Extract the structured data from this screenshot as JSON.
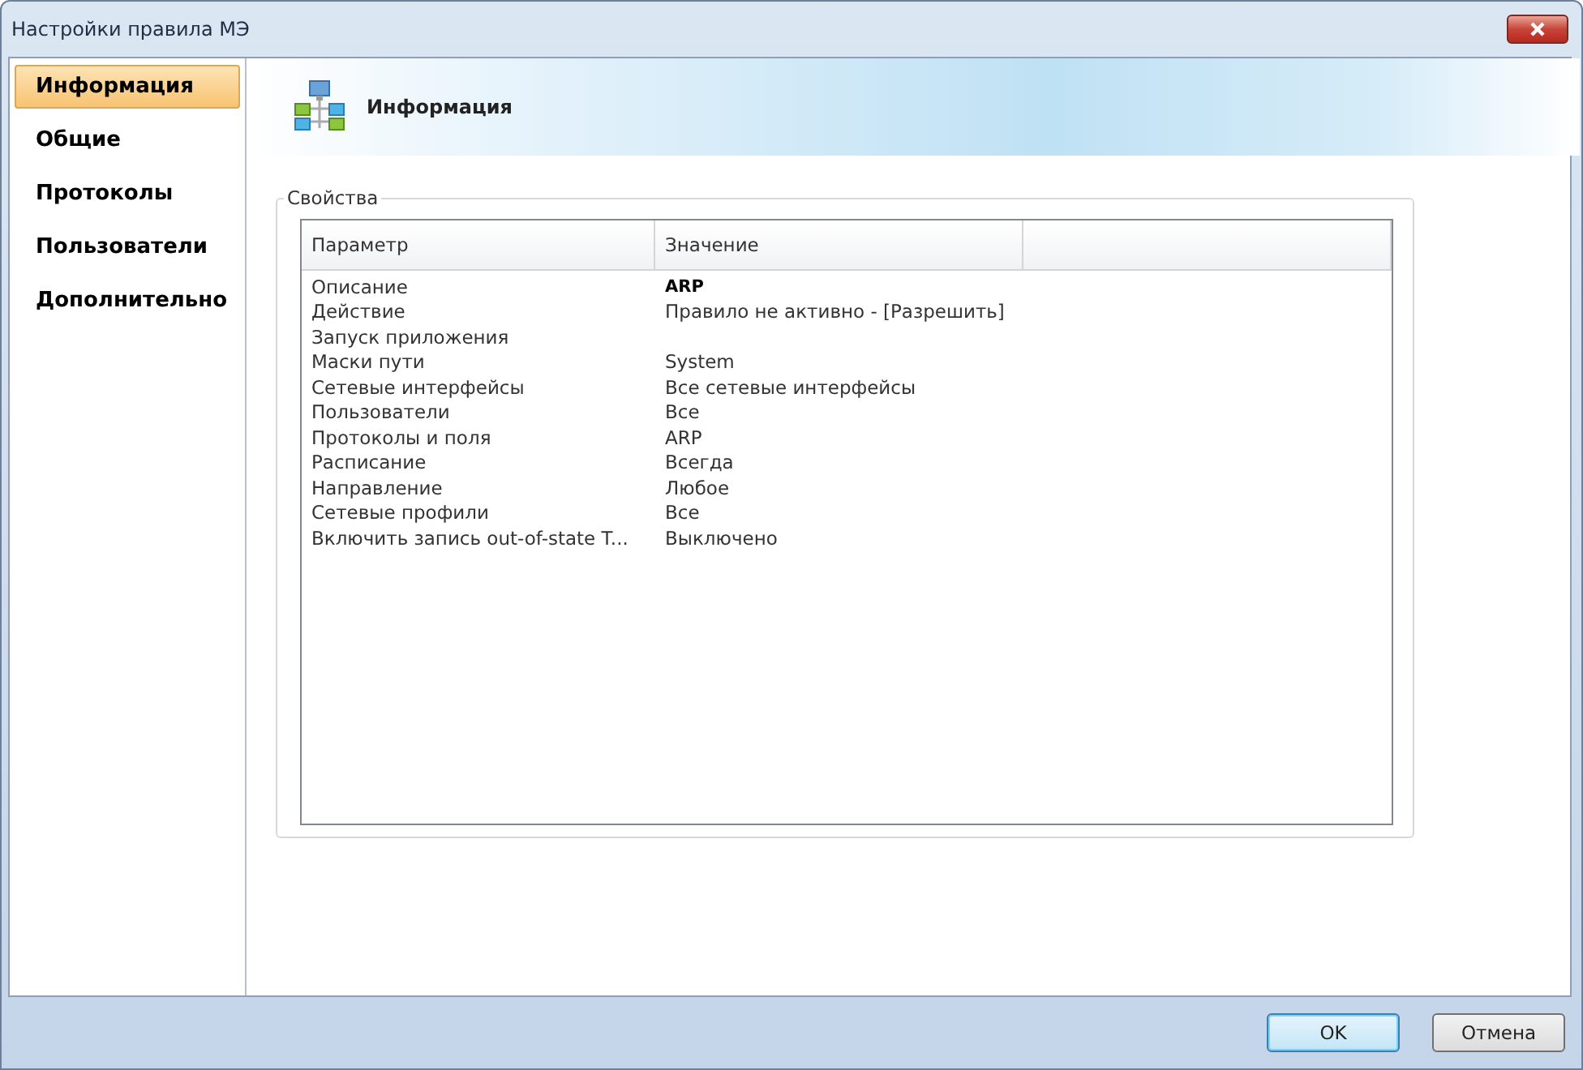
{
  "window": {
    "title": "Настройки правила МЭ"
  },
  "sidebar": {
    "items": [
      {
        "label": "Информация",
        "selected": true
      },
      {
        "label": "Общие",
        "selected": false
      },
      {
        "label": "Протоколы",
        "selected": false
      },
      {
        "label": "Пользователи",
        "selected": false
      },
      {
        "label": "Дополнительно",
        "selected": false
      }
    ]
  },
  "header": {
    "title": "Информация"
  },
  "properties": {
    "title": "Свойства",
    "columns": [
      "Параметр",
      "Значение"
    ],
    "rows": [
      {
        "name": "Описание",
        "value": "ARP",
        "emphasis": true
      },
      {
        "name": "Действие",
        "value": "Правило не активно - [Разрешить]"
      },
      {
        "name": "Запуск приложения"
      },
      {
        "name": "Маски пути",
        "value": "System"
      },
      {
        "name": "Сетевые интерфейсы",
        "value": "Все сетевые интерфейсы"
      },
      {
        "name": "Пользователи",
        "value": "Все"
      },
      {
        "name": "Протоколы и поля",
        "value": "ARP"
      },
      {
        "name": "Расписание",
        "value": "Всегда"
      },
      {
        "name": "Направление",
        "value": "Любое"
      },
      {
        "name": "Сетевые профили",
        "value": "Все"
      },
      {
        "name": "Включить запись out-of-state T...",
        "value": "Выключено"
      }
    ]
  },
  "buttons": [
    {
      "label": "OK",
      "default": true
    },
    {
      "label": "Отмена",
      "default": false
    }
  ]
}
